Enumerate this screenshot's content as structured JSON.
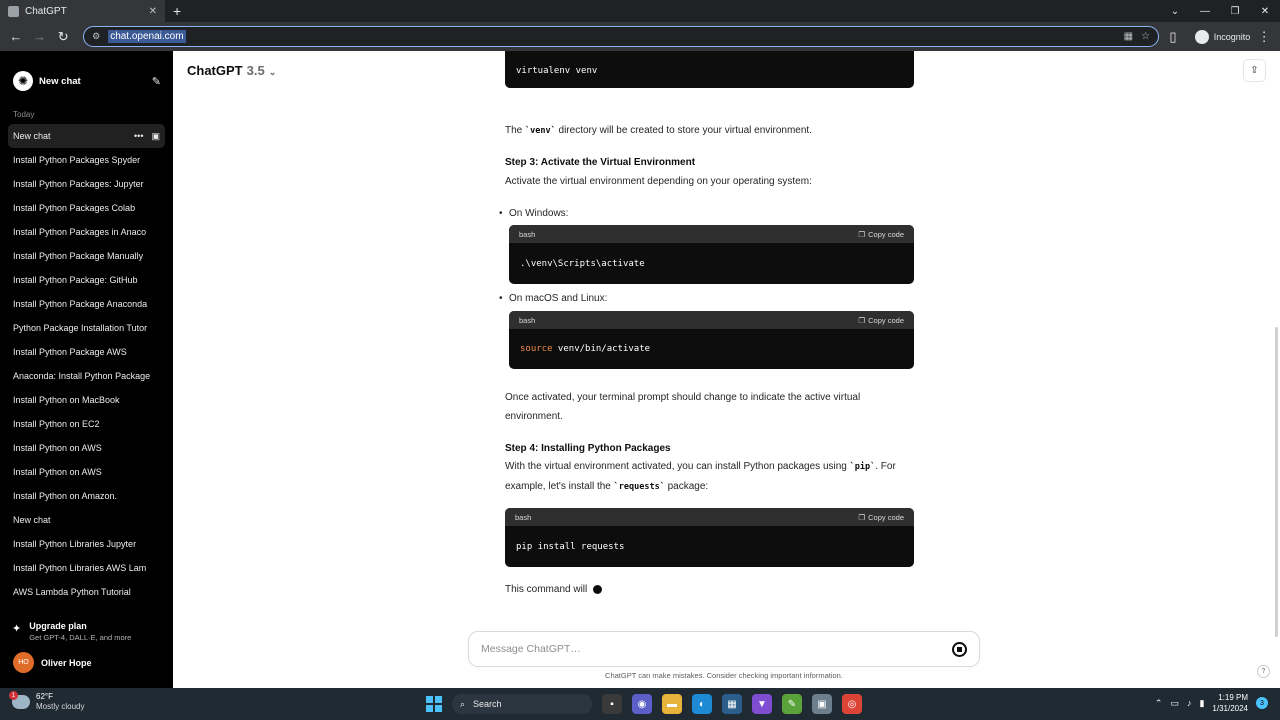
{
  "browser": {
    "tab_title": "ChatGPT",
    "url": "chat.openai.com",
    "profile_label": "Incognito"
  },
  "sidebar": {
    "new_chat_label": "New chat",
    "section_label": "Today",
    "items": [
      "New chat",
      "Install Python Packages Spyder",
      "Install Python Packages: Jupyter",
      "Install Python Packages Colab",
      "Install Python Packages in Anaco",
      "Install Python Package Manually",
      "Install Python Package: GitHub",
      "Install Python Package Anaconda",
      "Python Package Installation Tutor",
      "Install Python Package AWS",
      "Anaconda: Install Python Package",
      "Install Python on MacBook",
      "Install Python on EC2",
      "Install Python on AWS",
      "Install Python on AWS",
      "Install Python on Amazon.",
      "New chat",
      "Install Python Libraries Jupyter",
      "Install Python Libraries AWS Lam",
      "AWS Lambda Python Tutorial"
    ],
    "upgrade_title": "Upgrade plan",
    "upgrade_subtitle": "Get GPT-4, DALL·E, and more",
    "user_initials": "HO",
    "user_name": "Oliver Hope"
  },
  "header": {
    "model_name": "ChatGPT",
    "model_version": "3.5"
  },
  "conversation": {
    "code0": "virtualenv venv",
    "p1_pre": "The ",
    "p1_code": "`venv`",
    "p1_post": " directory will be created to store your virtual environment.",
    "step3_heading": "Step 3: Activate the Virtual Environment",
    "step3_text": "Activate the virtual environment depending on your operating system:",
    "bullet_windows": "On Windows:",
    "code1_lang": "bash",
    "copy_label": "Copy code",
    "code1": ".\\venv\\Scripts\\activate",
    "bullet_mac": "On macOS and Linux:",
    "code2_lang": "bash",
    "code2_keyword": "source",
    "code2_rest": " venv/bin/activate",
    "p2": "Once activated, your terminal prompt should change to indicate the active virtual environment.",
    "step4_heading": "Step 4: Installing Python Packages",
    "step4_pre": "With the virtual environment activated, you can install Python packages using ",
    "step4_code": "`pip`",
    "step4_mid": ". For example, let's install the ",
    "step4_code2": "`requests`",
    "step4_post": " package:",
    "code3_lang": "bash",
    "code3": "pip install requests",
    "p3": "This command will"
  },
  "composer": {
    "placeholder": "Message ChatGPT…",
    "disclaimer": "ChatGPT can make mistakes. Consider checking important information.",
    "help_label": "?"
  },
  "taskbar": {
    "weather_badge": "1",
    "temperature": "62°F",
    "condition": "Mostly cloudy",
    "search_label": "Search",
    "time": "1:19 PM",
    "date": "1/31/2024",
    "notification_count": "3"
  },
  "icons": [
    "chatgpt-logo-icon",
    "edit-icon",
    "more-icon",
    "archive-icon",
    "sparkle-icon",
    "share-icon",
    "stop-icon",
    "copy-icon",
    "back-icon",
    "forward-icon",
    "reload-icon",
    "star-icon",
    "incognito-icon"
  ]
}
